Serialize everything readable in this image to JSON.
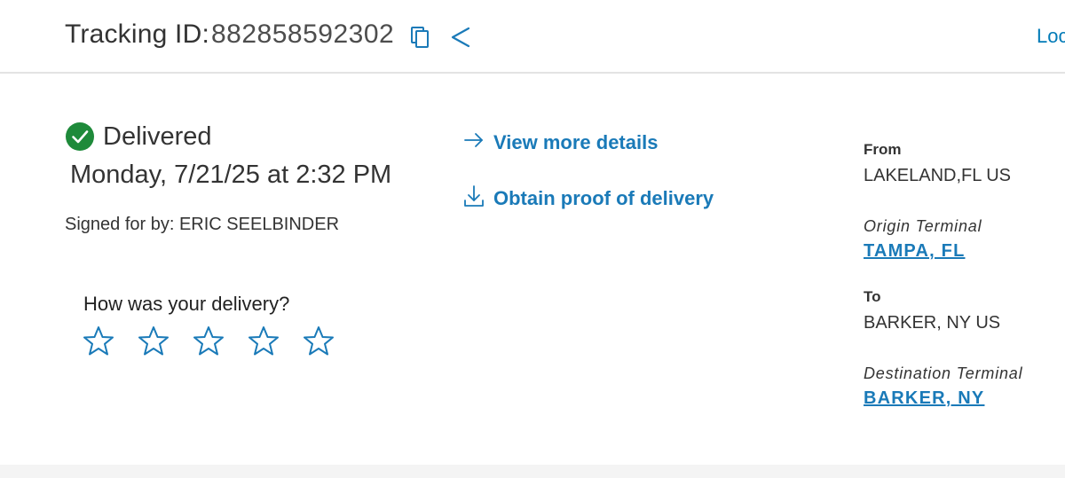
{
  "header": {
    "tracking_label": "Tracking ID:",
    "tracking_number": "882858592302",
    "right_link": "Loc",
    "copy_icon": "copy-icon",
    "share_icon": "share-icon"
  },
  "status": {
    "text": "Delivered",
    "icon": "check-circle-icon",
    "icon_color": "#1e8a3a",
    "date": "Monday, 7/21/25 at 2:32 PM",
    "signed_by": "Signed for by: ERIC SEELBINDER"
  },
  "rating": {
    "question": "How was your delivery?",
    "star_count": 5,
    "selected": 0
  },
  "actions": {
    "view_details": "View more details",
    "proof_of_delivery": "Obtain proof of delivery"
  },
  "shipment": {
    "from_label": "From",
    "from_value": "LAKELAND,FL US",
    "origin_terminal_label": "Origin Terminal",
    "origin_terminal_value": "TAMPA, FL",
    "to_label": "To",
    "to_value": "BARKER, NY US",
    "destination_terminal_label": "Destination Terminal",
    "destination_terminal_value": "BARKER, NY"
  },
  "colors": {
    "link": "#1a7ab8",
    "text": "#333333",
    "success": "#1e8a3a",
    "divider": "#e3e3e3"
  }
}
